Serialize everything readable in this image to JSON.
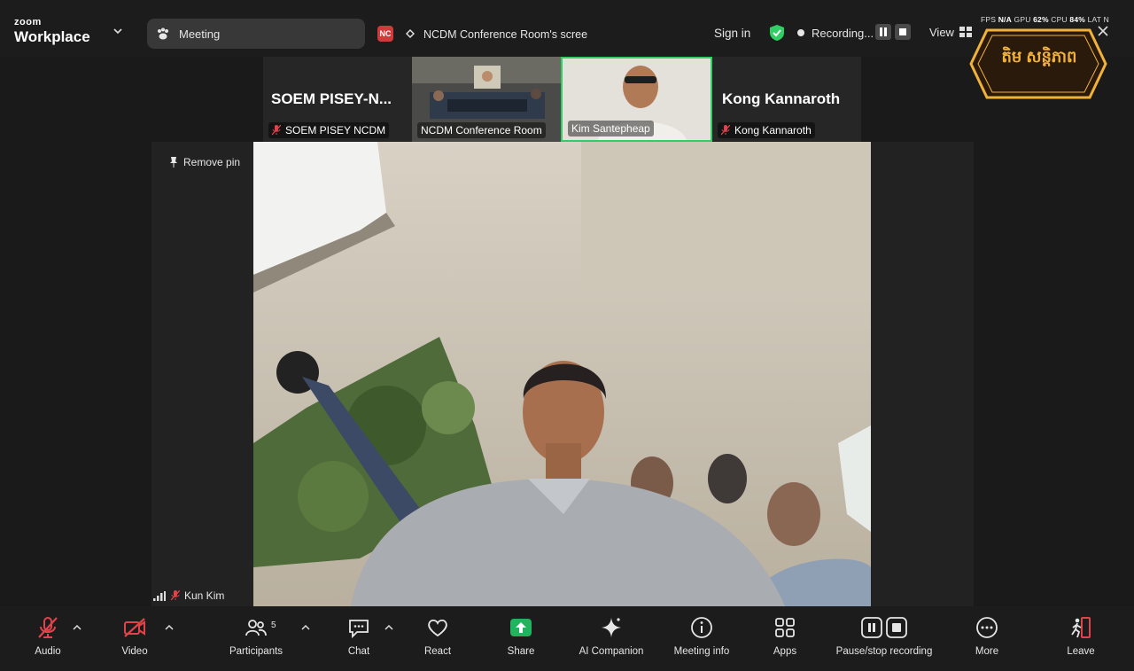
{
  "titlebar": {
    "brand_small": "zoom",
    "brand_large": "Workplace",
    "meeting_tab": "Meeting",
    "share_badge": "NC",
    "share_title": "NCDM Conference Room's scree",
    "sign_in": "Sign in",
    "recording_status": "Recording...",
    "view_label": "View",
    "stats": {
      "fps_label": "FPS",
      "fps_value": "N/A",
      "gpu_label": "GPU",
      "gpu_value": "62%",
      "cpu_label": "CPU",
      "cpu_value": "84%",
      "lat_label": "LAT",
      "extra": "N"
    }
  },
  "logo": {
    "text": "តិម សន្តិភាព"
  },
  "thumbnails": [
    {
      "big_name": "SOEM PISEY-N...",
      "label": "SOEM PISEY NCDM",
      "muted": true
    },
    {
      "big_name": "",
      "label": "NCDM Conference Room",
      "muted": false
    },
    {
      "big_name": "",
      "label": "Kim Santepheap",
      "muted": false
    },
    {
      "big_name": "Kong Kannaroth",
      "label": "Kong Kannaroth",
      "muted": true
    }
  ],
  "main": {
    "remove_pin": "Remove pin",
    "speaker_name": "Kun Kim"
  },
  "toolbar": {
    "audio": "Audio",
    "video": "Video",
    "participants": "Participants",
    "participants_count": "5",
    "chat": "Chat",
    "react": "React",
    "share": "Share",
    "ai_companion": "AI Companion",
    "meeting_info": "Meeting info",
    "apps": "Apps",
    "pause_stop": "Pause/stop recording",
    "more": "More",
    "leave": "Leave"
  },
  "colors": {
    "active_speaker": "#2fcf63",
    "share_green": "#22b35e",
    "muted_red": "#e0434b",
    "logo_gold": "#f0b23a",
    "leave_red": "#e0434b"
  }
}
